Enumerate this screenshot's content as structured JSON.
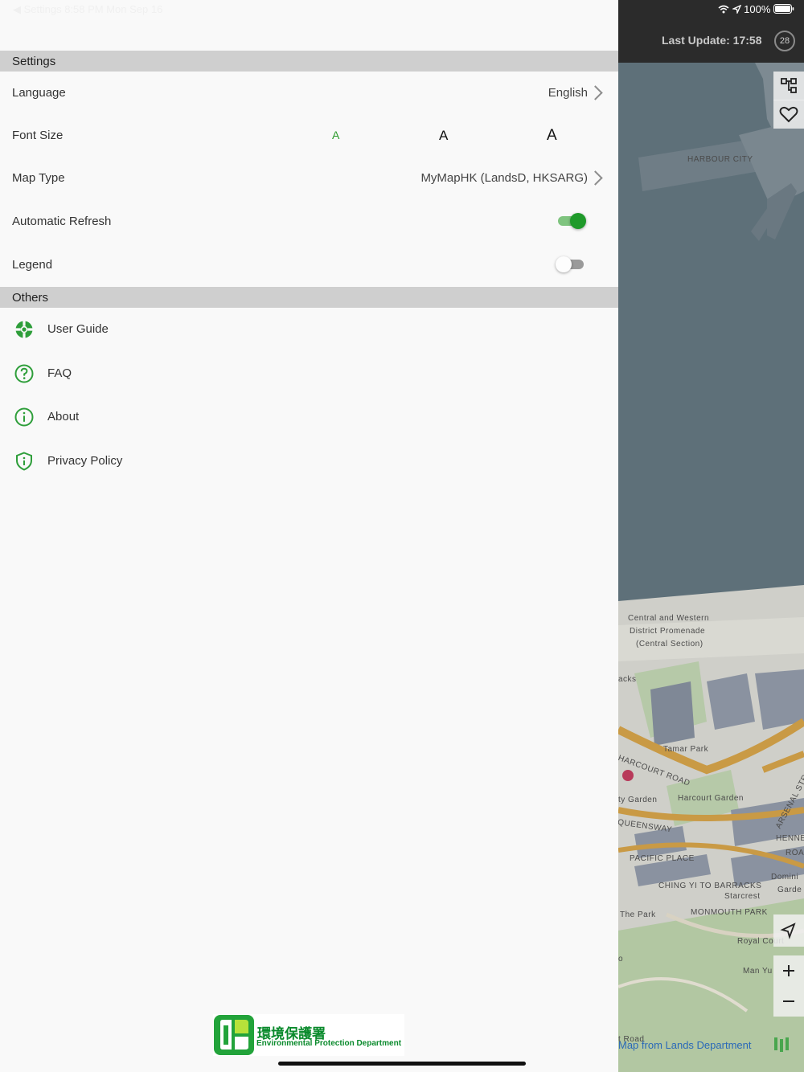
{
  "status_bar": {
    "left_text": "◀ Settings  8:58 PM  Mon Sep 16",
    "battery": "100%"
  },
  "settings": {
    "section_title": "Settings",
    "language": {
      "label": "Language",
      "value": "English"
    },
    "font_size": {
      "label": "Font Size",
      "small": "A",
      "medium": "A",
      "large": "A"
    },
    "map_type": {
      "label": "Map Type",
      "value": "MyMapHK (LandsD, HKSARG)"
    },
    "automatic_refresh": {
      "label": "Automatic Refresh",
      "on": true
    },
    "legend": {
      "label": "Legend",
      "on": false
    }
  },
  "others": {
    "section_title": "Others",
    "items": [
      {
        "label": "User Guide",
        "icon": "lifebuoy-icon"
      },
      {
        "label": "FAQ",
        "icon": "question-circle-icon"
      },
      {
        "label": "About",
        "icon": "info-circle-icon"
      },
      {
        "label": "Privacy Policy",
        "icon": "shield-info-icon"
      }
    ]
  },
  "logo": {
    "zh": "環境保護署",
    "en": "Environmental Protection Department"
  },
  "map": {
    "last_update": "Last Update: 17:58",
    "badge": "28",
    "labels": {
      "harbour_city": "HARBOUR CITY",
      "promenade_1": "Central and Western",
      "promenade_2": "District Promenade",
      "promenade_3": "(Central Section)",
      "acks": "acks",
      "harcourt_road": "HARCOURT ROAD",
      "tamar_park": "Tamar Park",
      "ty_garden": "ty Garden",
      "harcourt_garden": "Harcourt Garden",
      "queensway": "QUEENSWAY",
      "arsenal": "ARSENAL STR",
      "henne": "HENNE",
      "roa": "ROA",
      "pacific_place": "PACIFIC PLACE",
      "domini": "Domini",
      "garde": "Garde",
      "barracks": "CHING YI TO BARRACKS",
      "starcrest": "Starcrest",
      "the_park": "The Park",
      "monmouth": "MONMOUTH PARK",
      "royal_court": "Royal Court",
      "man_yu": "Man Yu",
      "o": "o",
      "t_road": "t Road",
      "credit": "Map from Lands Department"
    },
    "colors": {
      "water": "#5d6f7a",
      "land": "#cfcfc9",
      "park": "#a9c49a",
      "road": "#c99a45"
    }
  }
}
